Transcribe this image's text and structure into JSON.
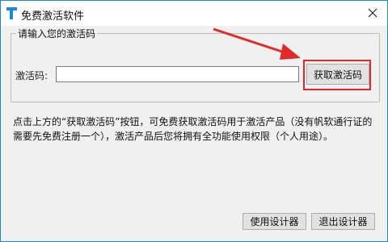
{
  "window": {
    "title": "免费激活软件",
    "close_icon": "close-icon",
    "app_icon": "app-logo-icon",
    "accent": "#1c88d8"
  },
  "group": {
    "legend": "请输入您的激活码",
    "code_label": "激活码:",
    "code_value": "",
    "get_code_button": "获取激活码",
    "highlight_color": "#e02a2a"
  },
  "info": {
    "text": "点击上方的“获取激活码”按钮，可免费获取激活码用于激活产品（没有帆软通行证的需要先免费注册一个），激活产品后您将拥有全功能使用权限（个人用途）。"
  },
  "footer": {
    "use_designer_button": "使用设计器",
    "exit_designer_button": "退出设计器"
  }
}
